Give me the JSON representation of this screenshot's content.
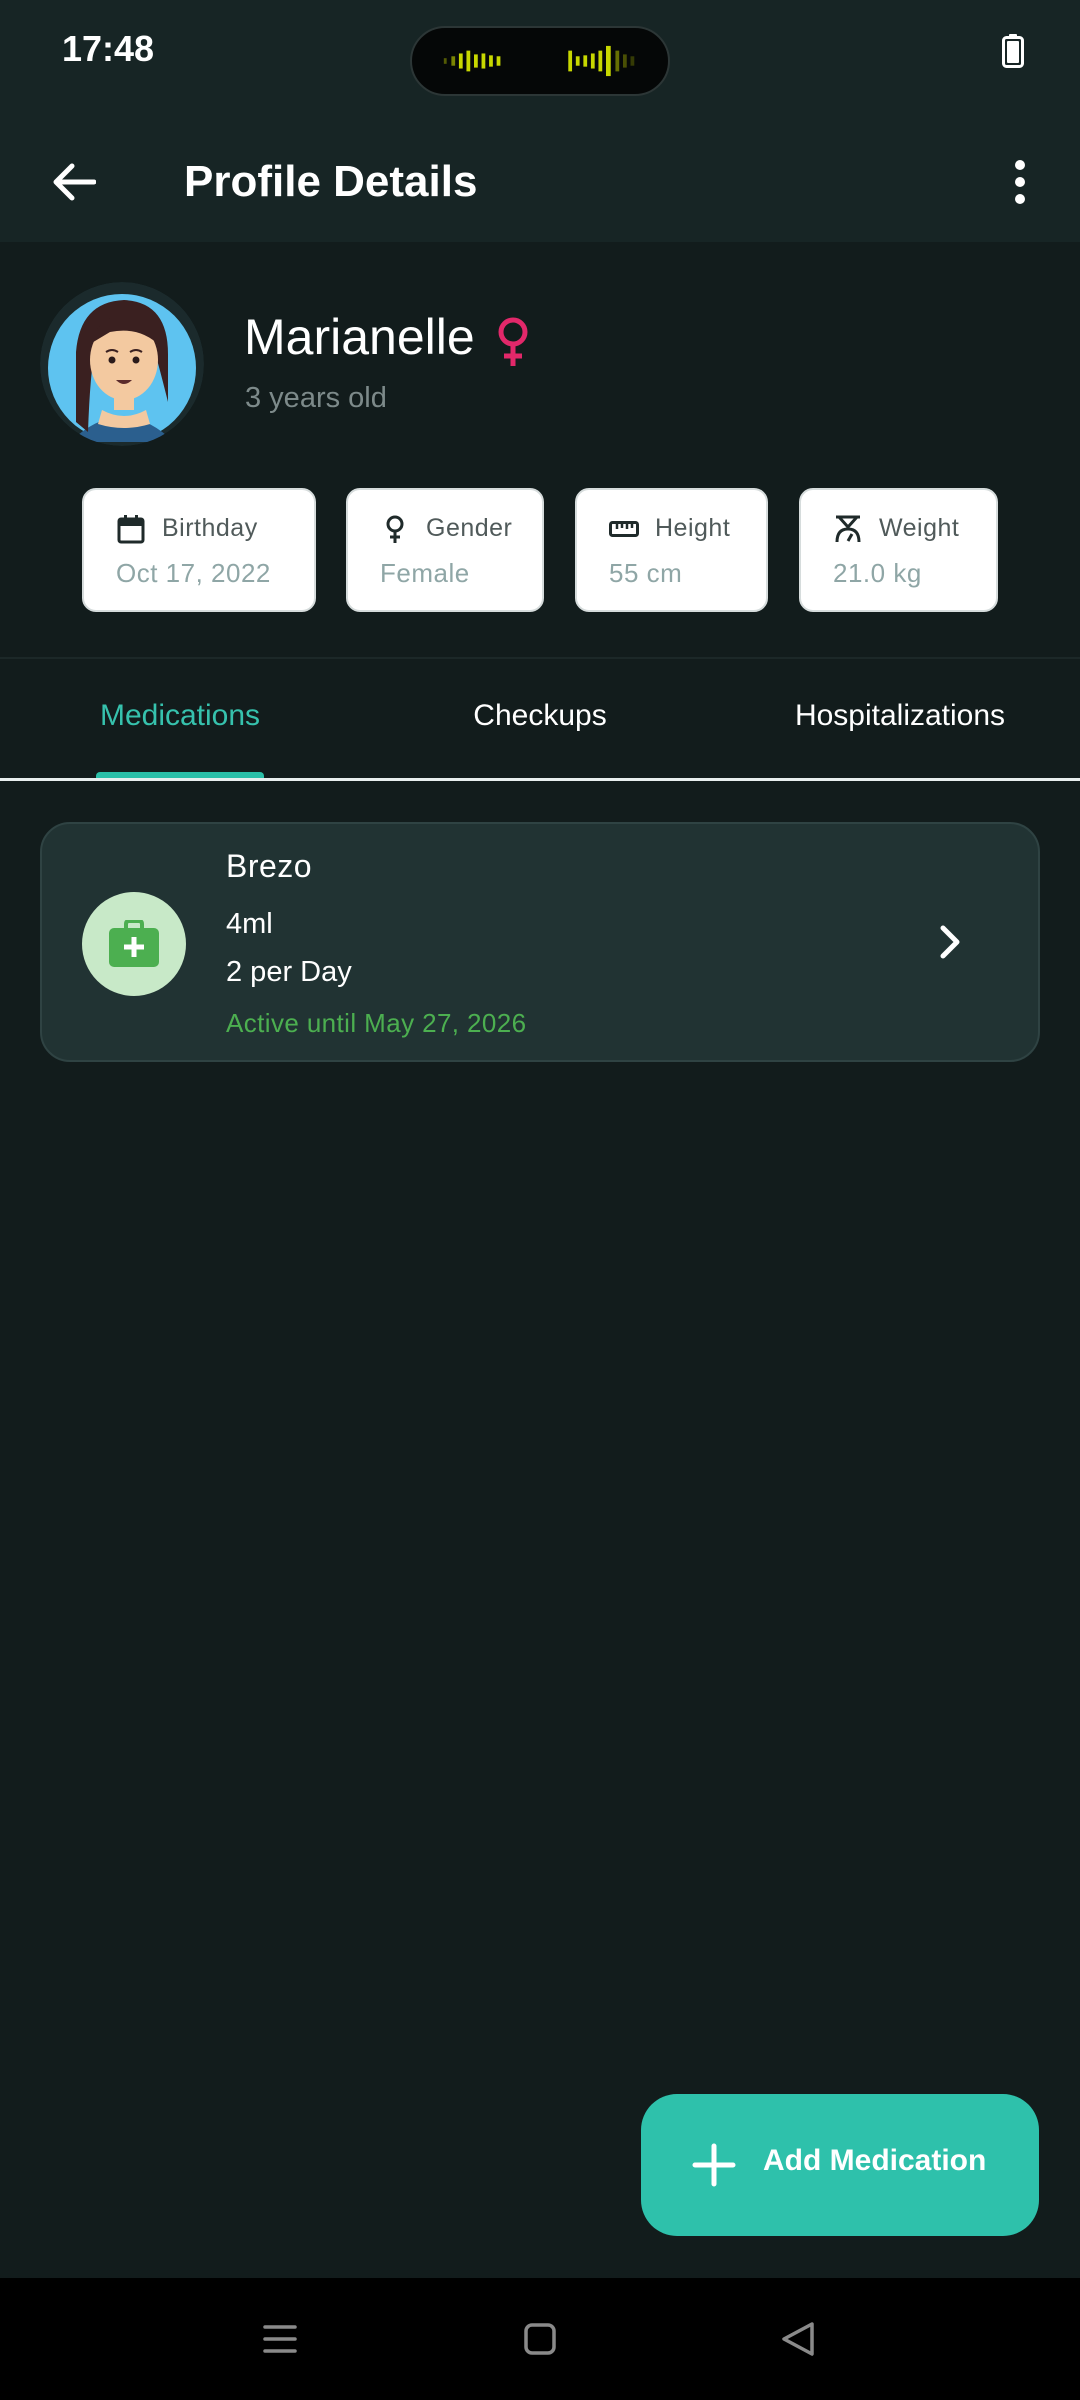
{
  "status_bar": {
    "time": "17:48"
  },
  "app_bar": {
    "title": "Profile Details"
  },
  "profile": {
    "name": "Marianelle",
    "age": "3 years old",
    "info_cards": [
      {
        "label": "Birthday",
        "value": "Oct 17, 2022",
        "icon": "calendar-icon"
      },
      {
        "label": "Gender",
        "value": "Female",
        "icon": "gender-icon"
      },
      {
        "label": "Height",
        "value": "55 cm",
        "icon": "ruler-icon"
      },
      {
        "label": "Weight",
        "value": "21.0 kg",
        "icon": "scale-icon"
      }
    ]
  },
  "tabs": [
    {
      "label": "Medications",
      "active": true
    },
    {
      "label": "Checkups",
      "active": false
    },
    {
      "label": "Hospitalizations",
      "active": false
    }
  ],
  "medications": [
    {
      "name": "Brezo",
      "dose": "4ml",
      "frequency": "2 per Day",
      "status": "Active until May 27, 2026",
      "icon": "medical-kit-icon"
    }
  ],
  "fab": {
    "label": "Add Medication",
    "icon": "plus-icon"
  },
  "colors": {
    "background": "#121c1c",
    "app_bar": "#172525",
    "accent": "#2ec1ab",
    "active_status": "#4caf50",
    "gender_female": "#e2286a",
    "card_bg": "#213333"
  }
}
